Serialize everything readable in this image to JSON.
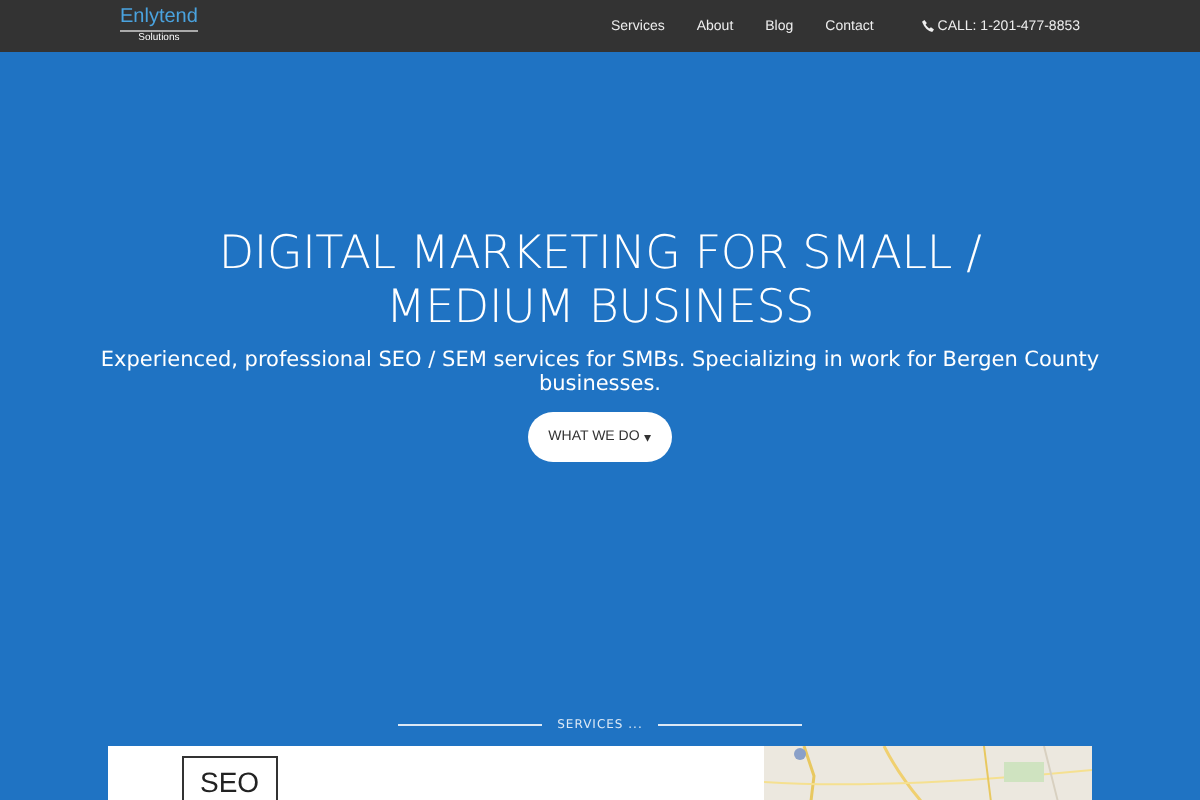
{
  "header": {
    "logo": {
      "name": "Enlytend",
      "tagline": "Solutions"
    },
    "nav": [
      {
        "label": "Services"
      },
      {
        "label": "About"
      },
      {
        "label": "Blog"
      },
      {
        "label": "Contact"
      }
    ],
    "phone": "CALL: 1-201-477-8853"
  },
  "hero": {
    "title": "DIGITAL MARKETING FOR SMALL / MEDIUM BUSINESS",
    "subtitle": "Experienced, professional SEO / SEM services for SMBs. Specializing in work for Bergen County businesses.",
    "button": "WHAT WE DO",
    "button_caret": "▾"
  },
  "services": {
    "heading": "SERVICES ...",
    "card": {
      "badge": "SEO",
      "kind": "picture"
    }
  }
}
